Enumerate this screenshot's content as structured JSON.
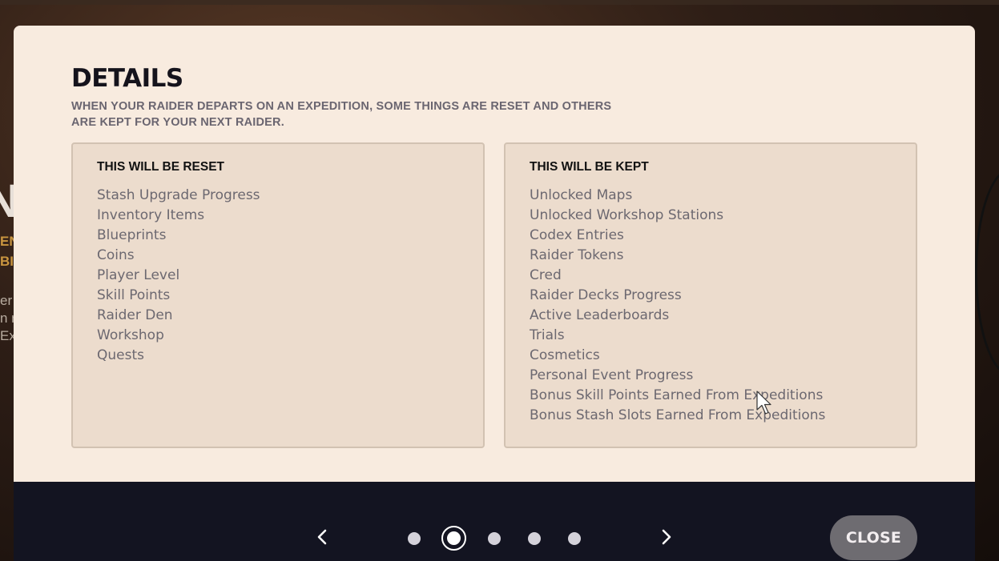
{
  "background": {
    "big_letter": "N",
    "gold_lines": [
      "EN",
      "BI"
    ],
    "grey_lines": [
      "er",
      "n r",
      "Ex"
    ]
  },
  "modal": {
    "title": "DETAILS",
    "subtitle": "WHEN YOUR RAIDER DEPARTS ON AN EXPEDITION, SOME THINGS ARE RESET AND OTHERS ARE KEPT FOR YOUR NEXT RAIDER.",
    "reset_panel": {
      "heading": "THIS WILL BE RESET",
      "items": [
        "Stash Upgrade Progress",
        "Inventory Items",
        "Blueprints",
        "Coins",
        "Player Level",
        "Skill Points",
        "Raider Den",
        "Workshop",
        "Quests"
      ]
    },
    "kept_panel": {
      "heading": "THIS WILL BE KEPT",
      "items": [
        "Unlocked Maps",
        "Unlocked Workshop Stations",
        "Codex Entries",
        "Raider Tokens",
        "Cred",
        "Raider Decks Progress",
        "Active Leaderboards",
        "Trials",
        "Cosmetics",
        "Personal Event Progress",
        "Bonus Skill Points Earned From Expeditions",
        "Bonus Stash Slots Earned From Expeditions"
      ]
    }
  },
  "footer": {
    "prev_icon": "chevron-left-icon",
    "next_icon": "chevron-right-icon",
    "page_count": 5,
    "current_page": 2,
    "close_label": "CLOSE"
  },
  "colors": {
    "modal_bg": "#f8ebdf",
    "panel_bg": "#ecdccd",
    "footer_bg": "#131421",
    "close_button_bg": "#6e6c71",
    "title_text": "#15131c",
    "item_text": "#6c6870"
  }
}
